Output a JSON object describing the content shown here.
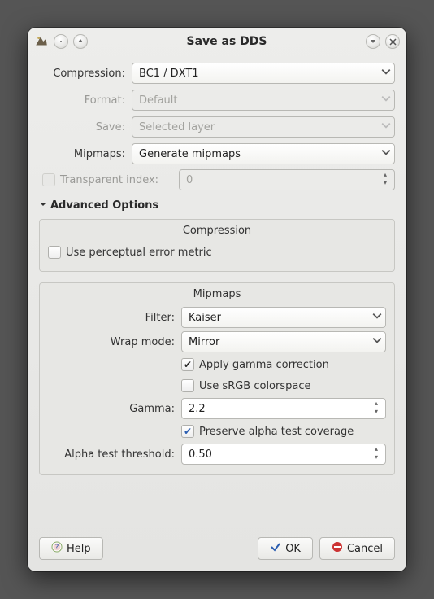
{
  "window": {
    "title": "Save as DDS"
  },
  "fields": {
    "compression": {
      "label": "Compression:",
      "value": "BC1 / DXT1"
    },
    "format": {
      "label": "Format:",
      "value": "Default",
      "disabled": true
    },
    "save": {
      "label": "Save:",
      "value": "Selected layer",
      "disabled": true
    },
    "mipmaps": {
      "label": "Mipmaps:",
      "value": "Generate mipmaps"
    },
    "transparent_index": {
      "label": "Transparent index:",
      "value": "0",
      "disabled": true
    }
  },
  "advanced": {
    "label": "Advanced Options",
    "compression": {
      "title": "Compression",
      "perceptual": {
        "label": "Use perceptual error metric",
        "checked": false
      }
    },
    "mipmaps": {
      "title": "Mipmaps",
      "filter": {
        "label": "Filter:",
        "value": "Kaiser"
      },
      "wrap": {
        "label": "Wrap mode:",
        "value": "Mirror"
      },
      "gamma_corr": {
        "label": "Apply gamma correction",
        "checked": true
      },
      "srgb": {
        "label": "Use sRGB colorspace",
        "checked": false
      },
      "gamma": {
        "label": "Gamma:",
        "value": "2.2"
      },
      "preserve_alpha": {
        "label": "Preserve alpha test coverage",
        "checked": true
      },
      "alpha_threshold": {
        "label": "Alpha test threshold:",
        "value": "0.50"
      }
    }
  },
  "buttons": {
    "help": "Help",
    "ok": "OK",
    "cancel": "Cancel"
  }
}
